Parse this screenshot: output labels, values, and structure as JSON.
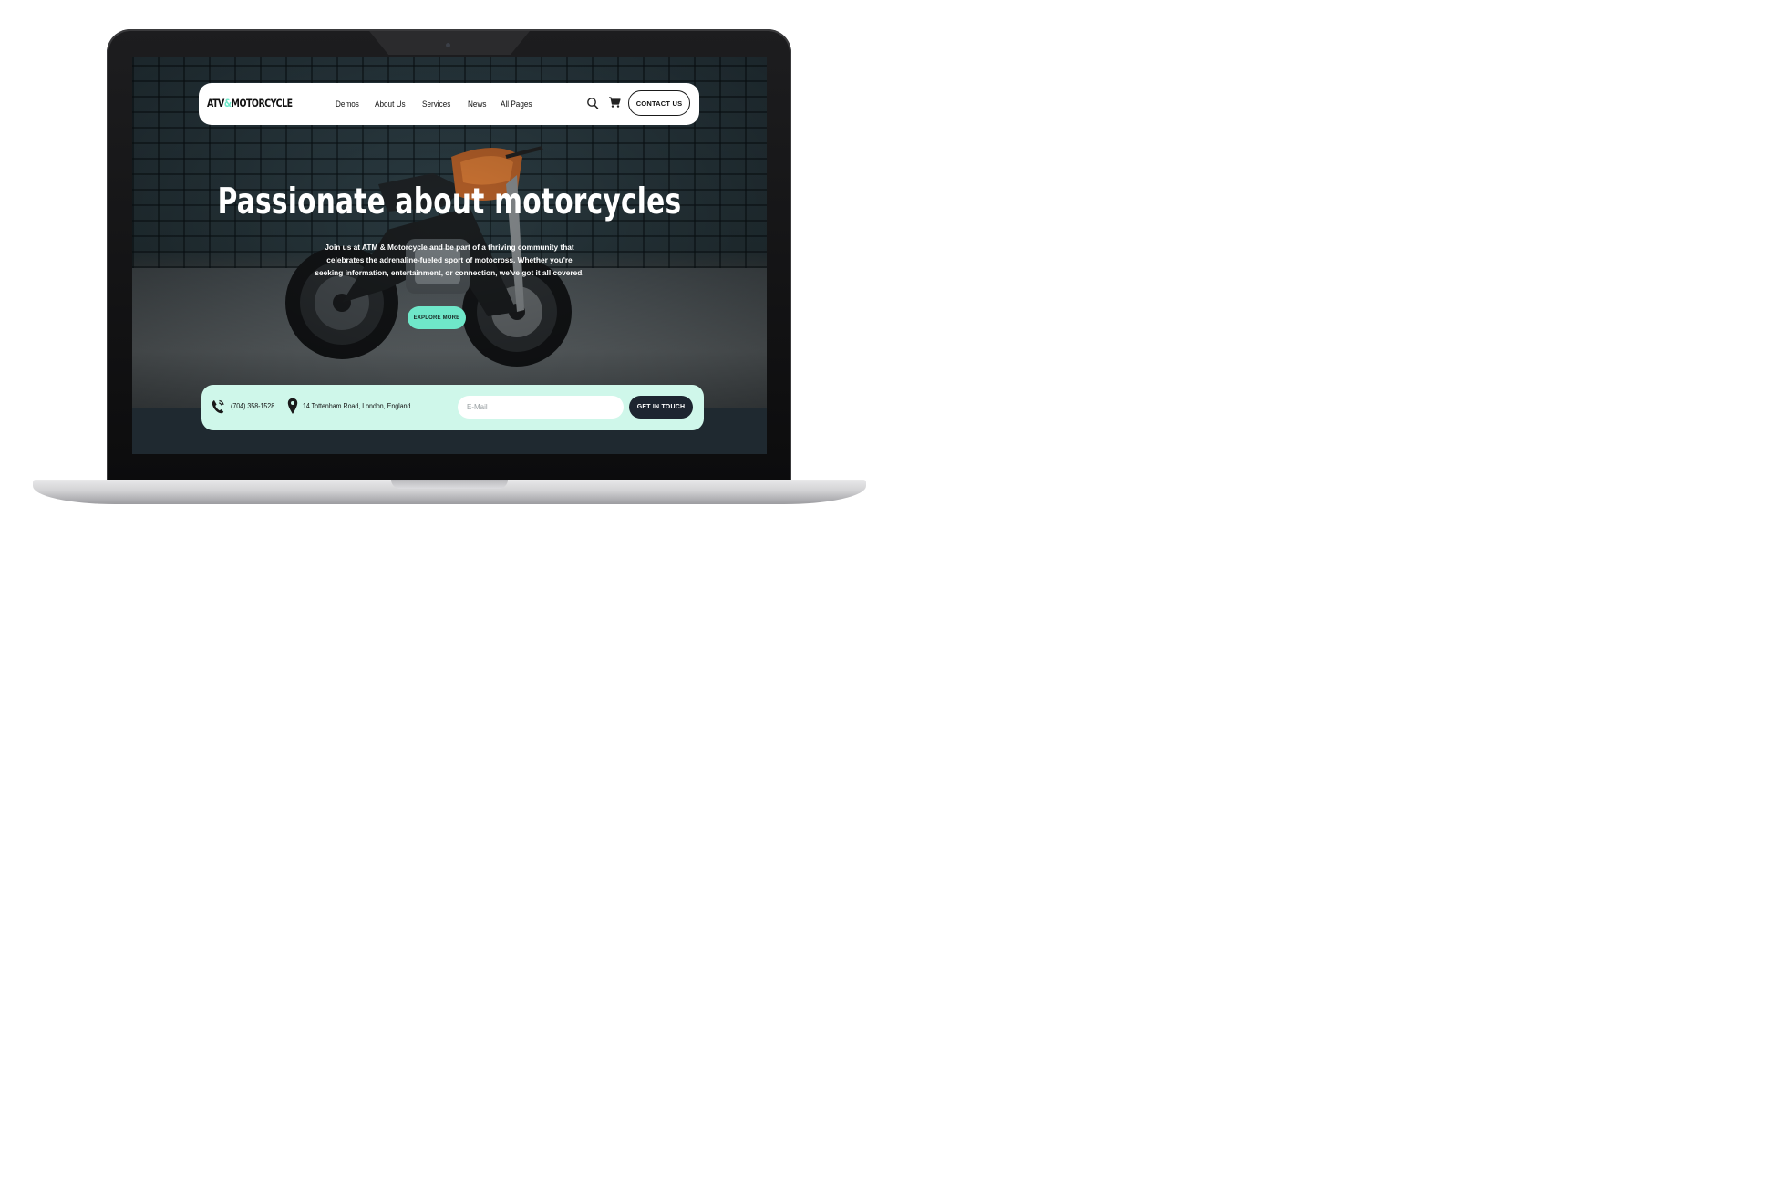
{
  "brand": {
    "logo_prefix": "ATV",
    "logo_amp": "&",
    "logo_suffix": "MOTORCYCLE",
    "accent_color": "#6fe7c9",
    "dark_color": "#1d2530"
  },
  "nav": {
    "links": [
      "Demos",
      "About Us",
      "Services",
      "News",
      "All Pages"
    ],
    "search_icon": "search-icon",
    "cart_icon": "cart-icon",
    "contact_label": "CONTACT US"
  },
  "hero": {
    "title": "Passionate about motorcycles",
    "subtitle": "Join us at ATM & Motorcycle and be part of a thriving community that celebrates the adrenaline-fueled sport of motocross. Whether you're seeking information, entertainment, or connection, we've got it all covered.",
    "cta_label": "EXPLORE MORE"
  },
  "contact_bar": {
    "phone_icon": "phone-icon",
    "phone": "(704) 358-1528",
    "location_icon": "map-pin-icon",
    "address": "14 Tottenham Road, London, England",
    "email_placeholder": "E-Mail",
    "submit_label": "GET IN TOUCH"
  }
}
